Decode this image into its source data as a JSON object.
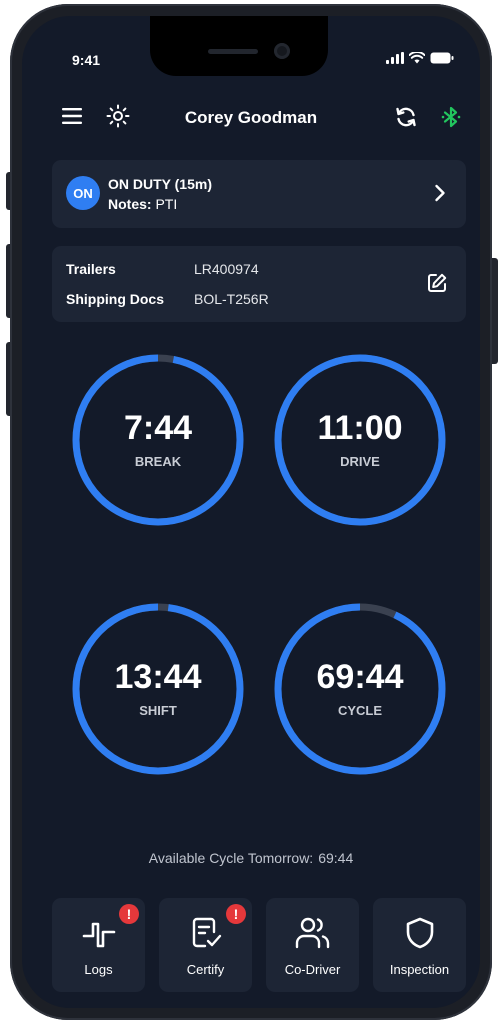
{
  "status_bar": {
    "time": "9:41"
  },
  "header": {
    "title": "Corey Goodman"
  },
  "duty": {
    "badge": "ON",
    "status": "ON DUTY (15m)",
    "notes_label": "Notes:",
    "notes_value": "PTI"
  },
  "shipment": {
    "trailers_label": "Trailers",
    "trailers_value": "LR400974",
    "docs_label": "Shipping Docs",
    "docs_value": "BOL-T256R"
  },
  "timers": [
    {
      "value": "7:44",
      "label": "BREAK",
      "remaining_fraction": 0.97
    },
    {
      "value": "11:00",
      "label": "DRIVE",
      "remaining_fraction": 1.0
    },
    {
      "value": "13:44",
      "label": "SHIFT",
      "remaining_fraction": 0.98
    },
    {
      "value": "69:44",
      "label": "CYCLE",
      "remaining_fraction": 0.93
    }
  ],
  "available": {
    "label": "Available Cycle Tomorrow:",
    "value": "69:44"
  },
  "bottom_nav": [
    {
      "label": "Logs",
      "alert": "!"
    },
    {
      "label": "Certify",
      "alert": "!"
    },
    {
      "label": "Co-Driver"
    },
    {
      "label": "Inspection"
    }
  ],
  "colors": {
    "background": "#131a29",
    "card": "#1d2535",
    "accent": "#2f7ef2",
    "gauge_track": "#3a4150",
    "alert": "#e5383b",
    "bluetooth": "#22c55e"
  },
  "icons": {
    "menu": "hamburger-menu-icon",
    "brightness": "sun-icon",
    "sync": "sync-icon",
    "bluetooth": "bluetooth-icon",
    "edit": "pencil-icon"
  }
}
